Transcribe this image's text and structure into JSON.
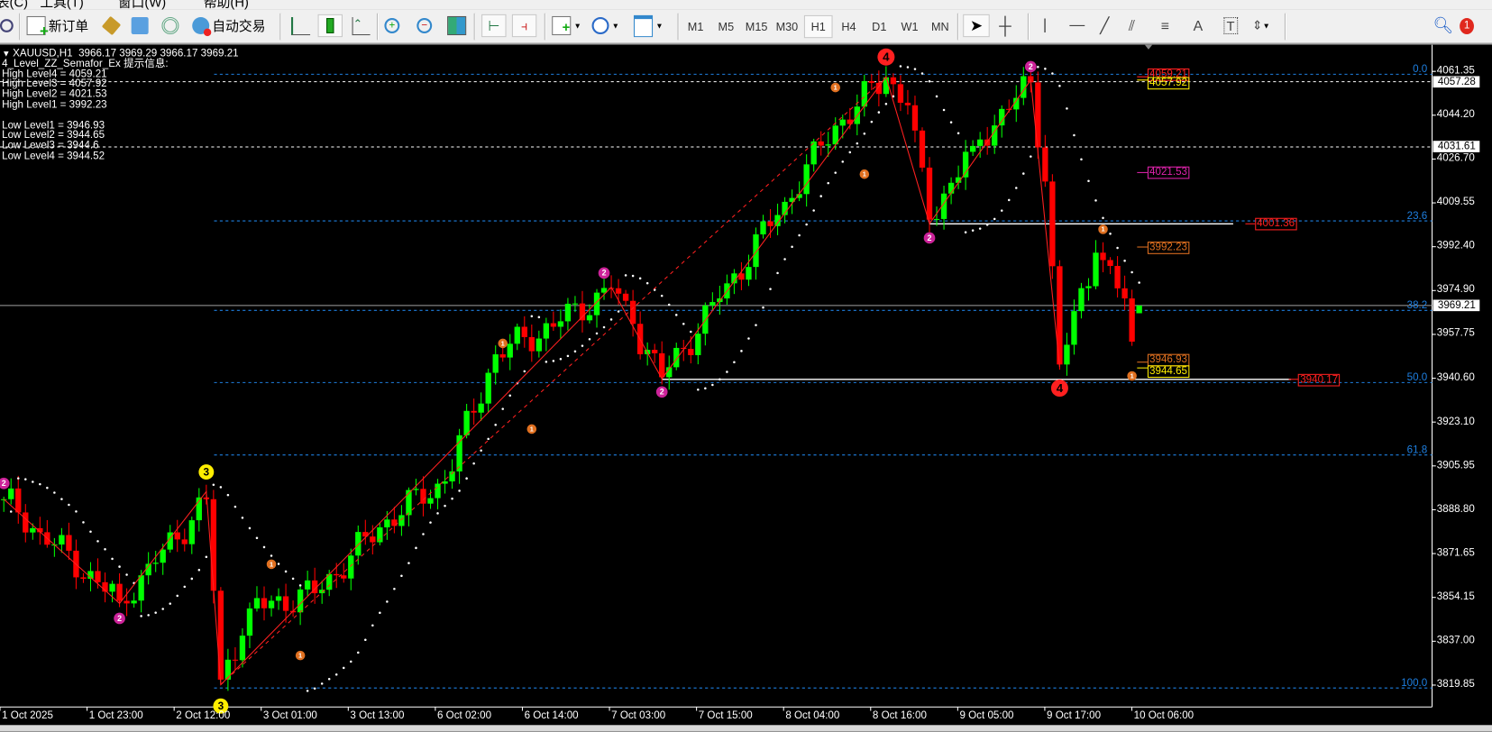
{
  "menu": [
    "表(C)",
    "工具(T)",
    "窗口(W)",
    "帮助(H)"
  ],
  "toolbar": {
    "new_order": "新订单",
    "auto_trading": "自动交易",
    "timeframes": [
      "M1",
      "M5",
      "M15",
      "M30",
      "H1",
      "H4",
      "D1",
      "W1",
      "MN"
    ],
    "active_timeframe": "H1",
    "notification_count": "1"
  },
  "chart_header": {
    "symbol_line": "XAUUSD,H1  3966.17 3969.29 3966.17 3969.21",
    "indicator_line": "4_Level_ZZ_Semafor_Ex 提示信息:",
    "levels": [
      "High Level4 = 4059.21",
      "High Level3 = 4057.92",
      "High Level2 = 4021.53",
      "High Level1 = 3992.23",
      "",
      "Low Level1 = 3946.93",
      "Low Level2 = 3944.65",
      "Low Level3 = 3944.6",
      "Low Level4 = 3944.52"
    ]
  },
  "price_axis": [
    "4061.35",
    "4044.20",
    "4026.70",
    "4009.55",
    "3992.40",
    "3974.90",
    "3957.75",
    "3940.60",
    "3923.10",
    "3905.95",
    "3888.80",
    "3871.65",
    "3854.15",
    "3837.00",
    "3819.85"
  ],
  "price_axis_highlights": [
    {
      "label": "4057.28",
      "price": 4057.28,
      "line": "white-dashed"
    },
    {
      "label": "4031.61",
      "price": 4031.61,
      "line": "white-dashed"
    },
    {
      "label": "3969.21",
      "price": 3969.21,
      "line": "gray-solid"
    }
  ],
  "time_axis": [
    "1 Oct 2025",
    "1 Oct 23:00",
    "2 Oct 12:00",
    "3 Oct 01:00",
    "3 Oct 13:00",
    "6 Oct 02:00",
    "6 Oct 14:00",
    "7 Oct 03:00",
    "7 Oct 15:00",
    "8 Oct 04:00",
    "8 Oct 16:00",
    "9 Oct 05:00",
    "9 Oct 17:00",
    "10 Oct 06:00"
  ],
  "fib_levels": [
    {
      "label": "0.0",
      "price": 4060.2
    },
    {
      "label": "23.6",
      "price": 4002.5
    },
    {
      "label": "38.2",
      "price": 3967.3
    },
    {
      "label": "50.0",
      "price": 3938.9
    },
    {
      "label": "61.8",
      "price": 3910.4
    },
    {
      "label": "100.0",
      "price": 3818.7
    }
  ],
  "level_boxes": [
    {
      "label": "4059.21",
      "price": 4059.21,
      "color": "#ff2020"
    },
    {
      "label": "4057.92",
      "price": 4057.92,
      "color": "#ffee00"
    },
    {
      "label": "4021.53",
      "price": 4021.53,
      "color": "#dd22aa"
    },
    {
      "label": "3992.23",
      "price": 3992.23,
      "color": "#e07020"
    },
    {
      "label": "3946.93",
      "price": 3946.93,
      "color": "#e07020"
    },
    {
      "label": "3944.65",
      "price": 3944.65,
      "color": "#ffee00"
    }
  ],
  "sr_lines": [
    {
      "label": "4001.36",
      "price": 4001.36,
      "from_bar": 128,
      "to_bar": 170,
      "label_bar": 173
    },
    {
      "label": "3940.17",
      "price": 3940.17,
      "from_bar": 91,
      "to_bar": 178,
      "label_bar": 179
    }
  ],
  "colors": {
    "bull": "#00ff00",
    "bear": "#ff0000",
    "zigzag": "#ff2020",
    "fib": "#1e7fe0",
    "level1": "#e07020",
    "level2": "#cc2299",
    "level3": "#ffee00",
    "level4": "#ff2020"
  },
  "chart_data": {
    "type": "candlestick",
    "symbol": "XAUUSD",
    "timeframe": "H1",
    "ylim": [
      3819.85,
      4061.35
    ],
    "last_bar": {
      "open": 3966.17,
      "high": 3969.29,
      "low": 3966.17,
      "close": 3969.21
    },
    "price_pivots": [
      [
        0,
        3893
      ],
      [
        5,
        3880
      ],
      [
        16,
        3853
      ],
      [
        21,
        3868
      ],
      [
        28,
        3893
      ],
      [
        30,
        3822
      ],
      [
        34,
        3850
      ],
      [
        43,
        3856
      ],
      [
        53,
        3885
      ],
      [
        61,
        3900
      ],
      [
        68,
        3950
      ],
      [
        77,
        3963
      ],
      [
        84,
        3976
      ],
      [
        87,
        3962
      ],
      [
        91,
        3941
      ],
      [
        99,
        3972
      ],
      [
        108,
        4010
      ],
      [
        115,
        4040
      ],
      [
        122,
        4059
      ],
      [
        125,
        4048
      ],
      [
        128,
        4003
      ],
      [
        134,
        4032
      ],
      [
        142,
        4057
      ],
      [
        144,
        4018
      ],
      [
        146,
        3946
      ],
      [
        151,
        3990
      ],
      [
        155,
        3972
      ],
      [
        156,
        3955
      ],
      [
        157,
        3969.21
      ]
    ],
    "zigzag_main": [
      [
        0,
        3893
      ],
      [
        16,
        3852
      ],
      [
        28,
        3896
      ],
      [
        30,
        3820
      ],
      [
        84,
        3976.4
      ],
      [
        91,
        3940.4
      ],
      [
        122,
        4059.2
      ],
      [
        128,
        4001.4
      ],
      [
        142,
        4057.9
      ],
      [
        146,
        3945
      ]
    ],
    "zigzag_major": [
      [
        30,
        3820
      ],
      [
        122,
        4059.2
      ]
    ],
    "semafor_points": [
      [
        0,
        3899.2,
        2
      ],
      [
        16,
        3846.1,
        2
      ],
      [
        28,
        3903.7,
        3
      ],
      [
        30,
        3811.6,
        3
      ],
      [
        37,
        3867.4,
        1
      ],
      [
        41,
        3831.5,
        1
      ],
      [
        69,
        3954.3,
        1
      ],
      [
        73,
        3920.6,
        1
      ],
      [
        83,
        3982.0,
        2
      ],
      [
        91,
        3935.2,
        2
      ],
      [
        115,
        4055.0,
        1
      ],
      [
        119,
        4020.9,
        1
      ],
      [
        122,
        4067.0,
        4
      ],
      [
        128,
        3995.8,
        2
      ],
      [
        142,
        4063.2,
        2
      ],
      [
        152,
        3999.2,
        1
      ],
      [
        146,
        3936.7,
        4
      ],
      [
        156,
        3941.5,
        1
      ]
    ]
  }
}
